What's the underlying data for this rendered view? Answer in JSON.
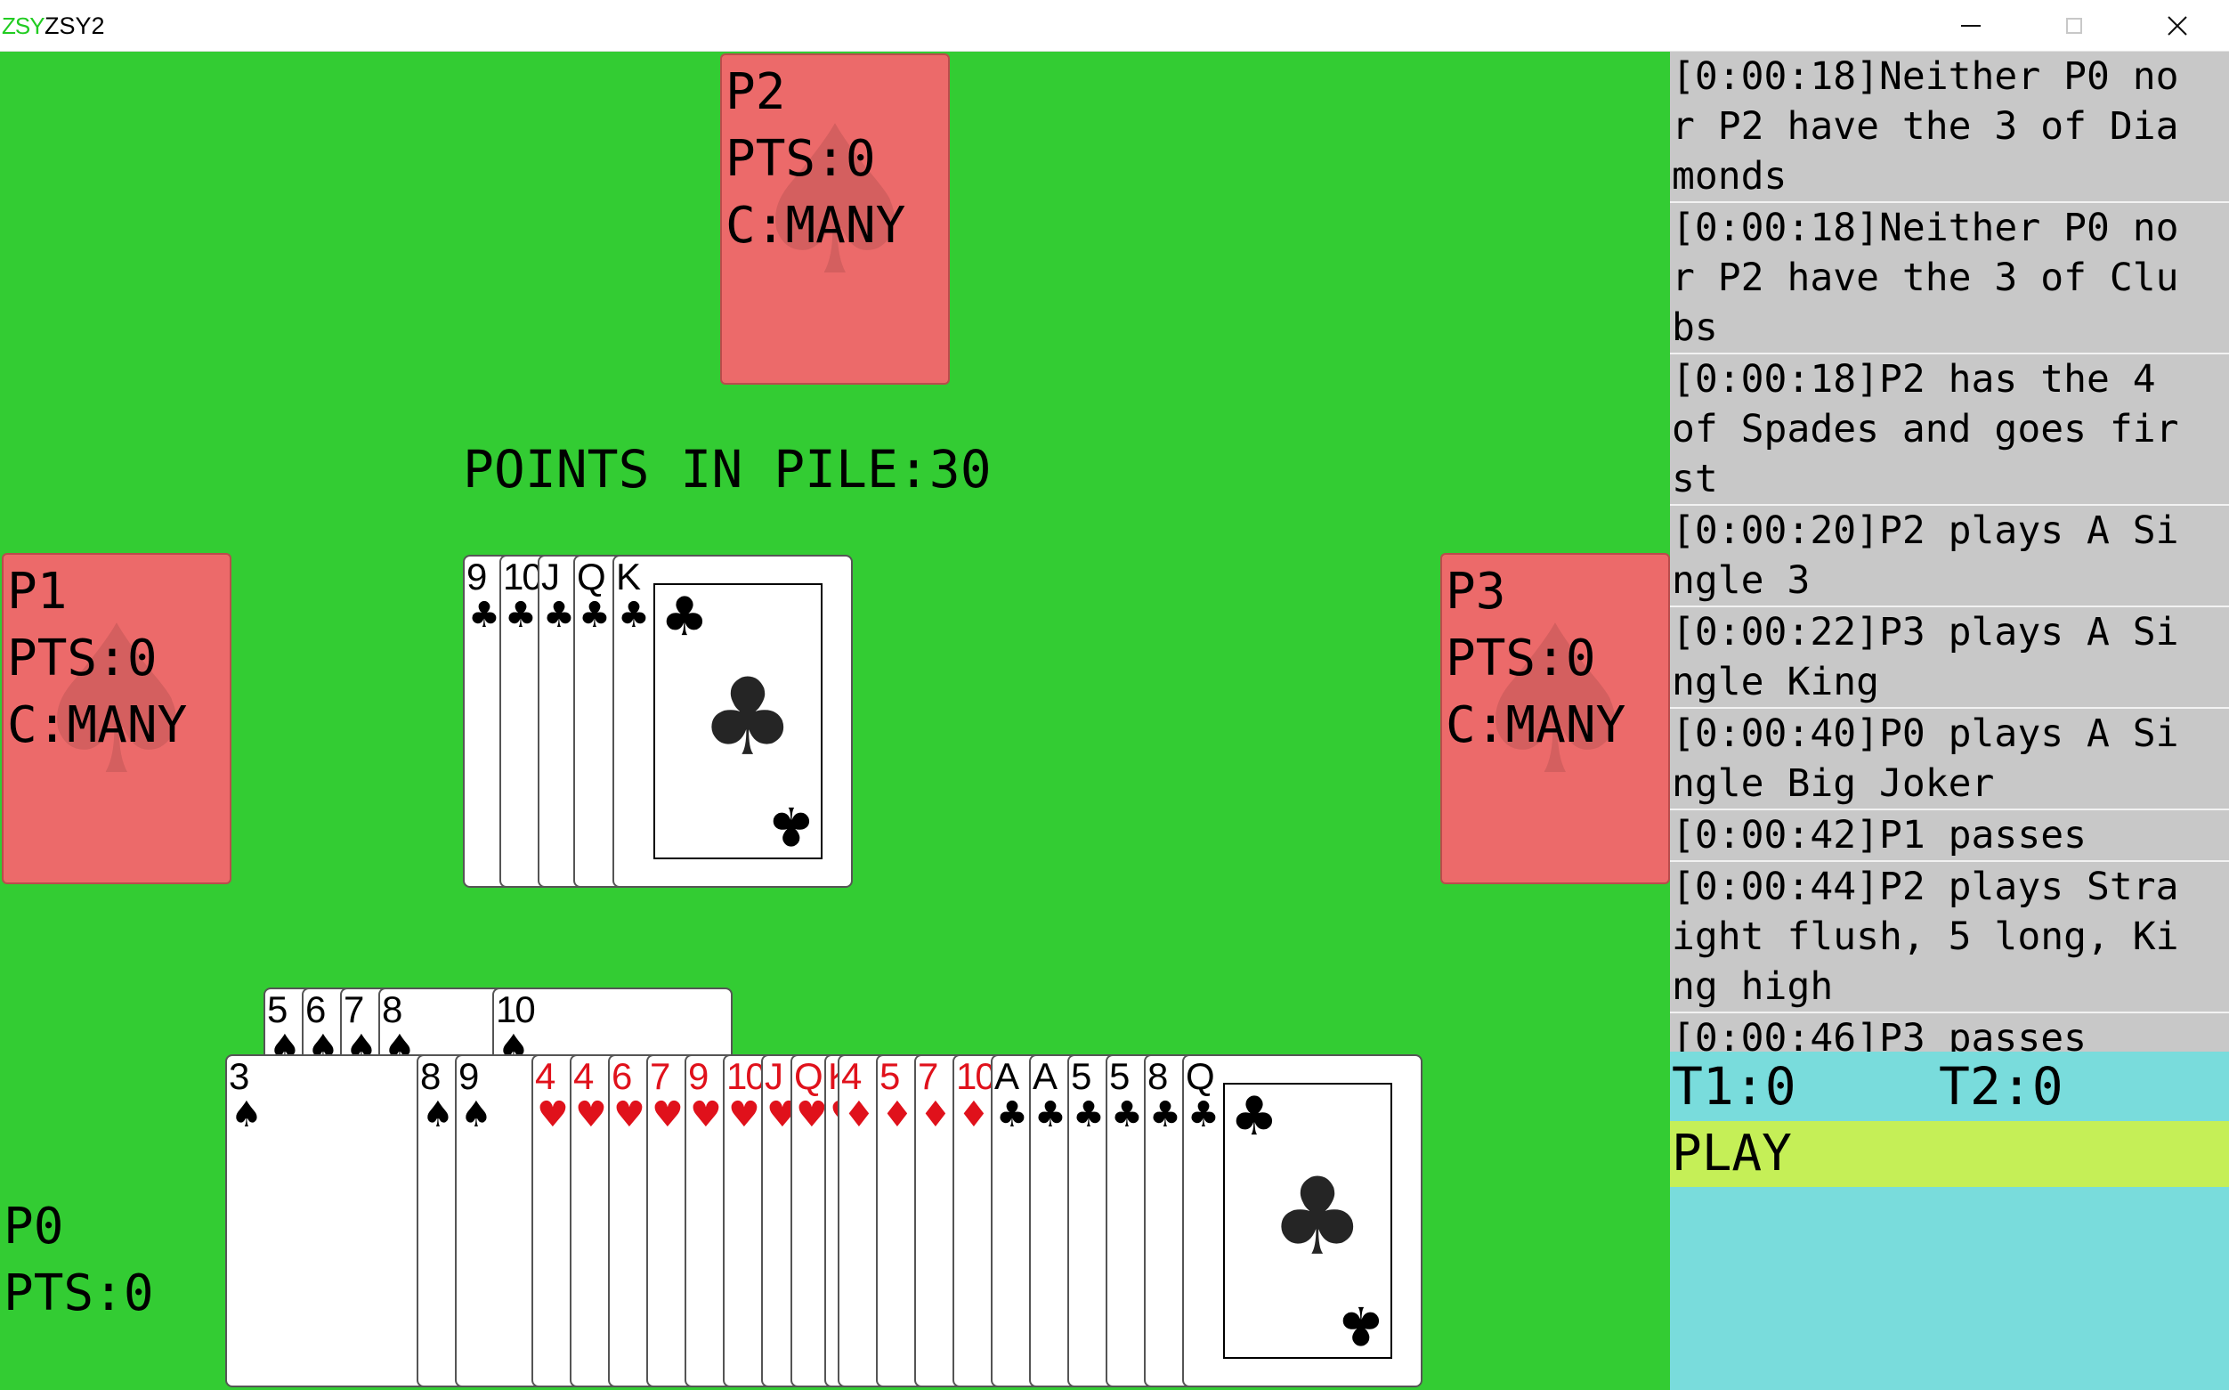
{
  "window": {
    "logo": "ZSY",
    "title": "ZSY2"
  },
  "opponents": {
    "p2": {
      "name": "P2",
      "pts": "PTS:0",
      "cards": "C:MANY"
    },
    "p1": {
      "name": "P1",
      "pts": "PTS:0",
      "cards": "C:MANY"
    },
    "p3": {
      "name": "P3",
      "pts": "PTS:0",
      "cards": "C:MANY"
    }
  },
  "pile": {
    "label": "POINTS IN PILE:30",
    "cards": [
      {
        "rank": "9",
        "suit": "♣"
      },
      {
        "rank": "10",
        "suit": "♣"
      },
      {
        "rank": "J",
        "suit": "♣"
      },
      {
        "rank": "Q",
        "suit": "♣"
      },
      {
        "rank": "K",
        "suit": "♣"
      }
    ]
  },
  "player": {
    "name": "P0",
    "pts": "PTS:0",
    "raised": [
      {
        "rank": "5",
        "suit": "♠"
      },
      {
        "rank": "6",
        "suit": "♠"
      },
      {
        "rank": "7",
        "suit": "♠"
      },
      {
        "rank": "8",
        "suit": "♠"
      },
      {
        "rank": "10",
        "suit": "♠"
      }
    ],
    "hand": [
      {
        "rank": "3",
        "suit": "♠"
      },
      {
        "rank": "8",
        "suit": "♠"
      },
      {
        "rank": "9",
        "suit": "♠"
      },
      {
        "rank": "4",
        "suit": "♥"
      },
      {
        "rank": "4",
        "suit": "♥"
      },
      {
        "rank": "6",
        "suit": "♥"
      },
      {
        "rank": "7",
        "suit": "♥"
      },
      {
        "rank": "9",
        "suit": "♥"
      },
      {
        "rank": "10",
        "suit": "♥"
      },
      {
        "rank": "J",
        "suit": "♥"
      },
      {
        "rank": "Q",
        "suit": "♥"
      },
      {
        "rank": "K",
        "suit": "♥"
      },
      {
        "rank": "4",
        "suit": "♦"
      },
      {
        "rank": "5",
        "suit": "♦"
      },
      {
        "rank": "7",
        "suit": "♦"
      },
      {
        "rank": "10",
        "suit": "♦"
      },
      {
        "rank": "A",
        "suit": "♣"
      },
      {
        "rank": "A",
        "suit": "♣"
      },
      {
        "rank": "5",
        "suit": "♣"
      },
      {
        "rank": "5",
        "suit": "♣"
      },
      {
        "rank": "8",
        "suit": "♣"
      },
      {
        "rank": "Q",
        "suit": "♣"
      }
    ]
  },
  "log": [
    "[0:00:18]Neither P0 no\nr P2 have the 3 of Dia\nmonds",
    "[0:00:18]Neither P0 no\nr P2 have the 3 of Clu\nbs",
    "[0:00:18]P2 has the 4 \nof Spades and goes fir\nst",
    "[0:00:20]P2 plays A Si\nngle 3",
    "[0:00:22]P3 plays A Si\nngle King",
    "[0:00:40]P0 plays A Si\nngle Big Joker",
    "[0:00:42]P1 passes",
    "[0:00:44]P2 plays Stra\night flush, 5 long, Ki\nng high",
    "[0:00:46]P3 passes"
  ],
  "score": {
    "t1": "T1:0",
    "t2": "T2:0"
  },
  "play_button": "PLAY"
}
